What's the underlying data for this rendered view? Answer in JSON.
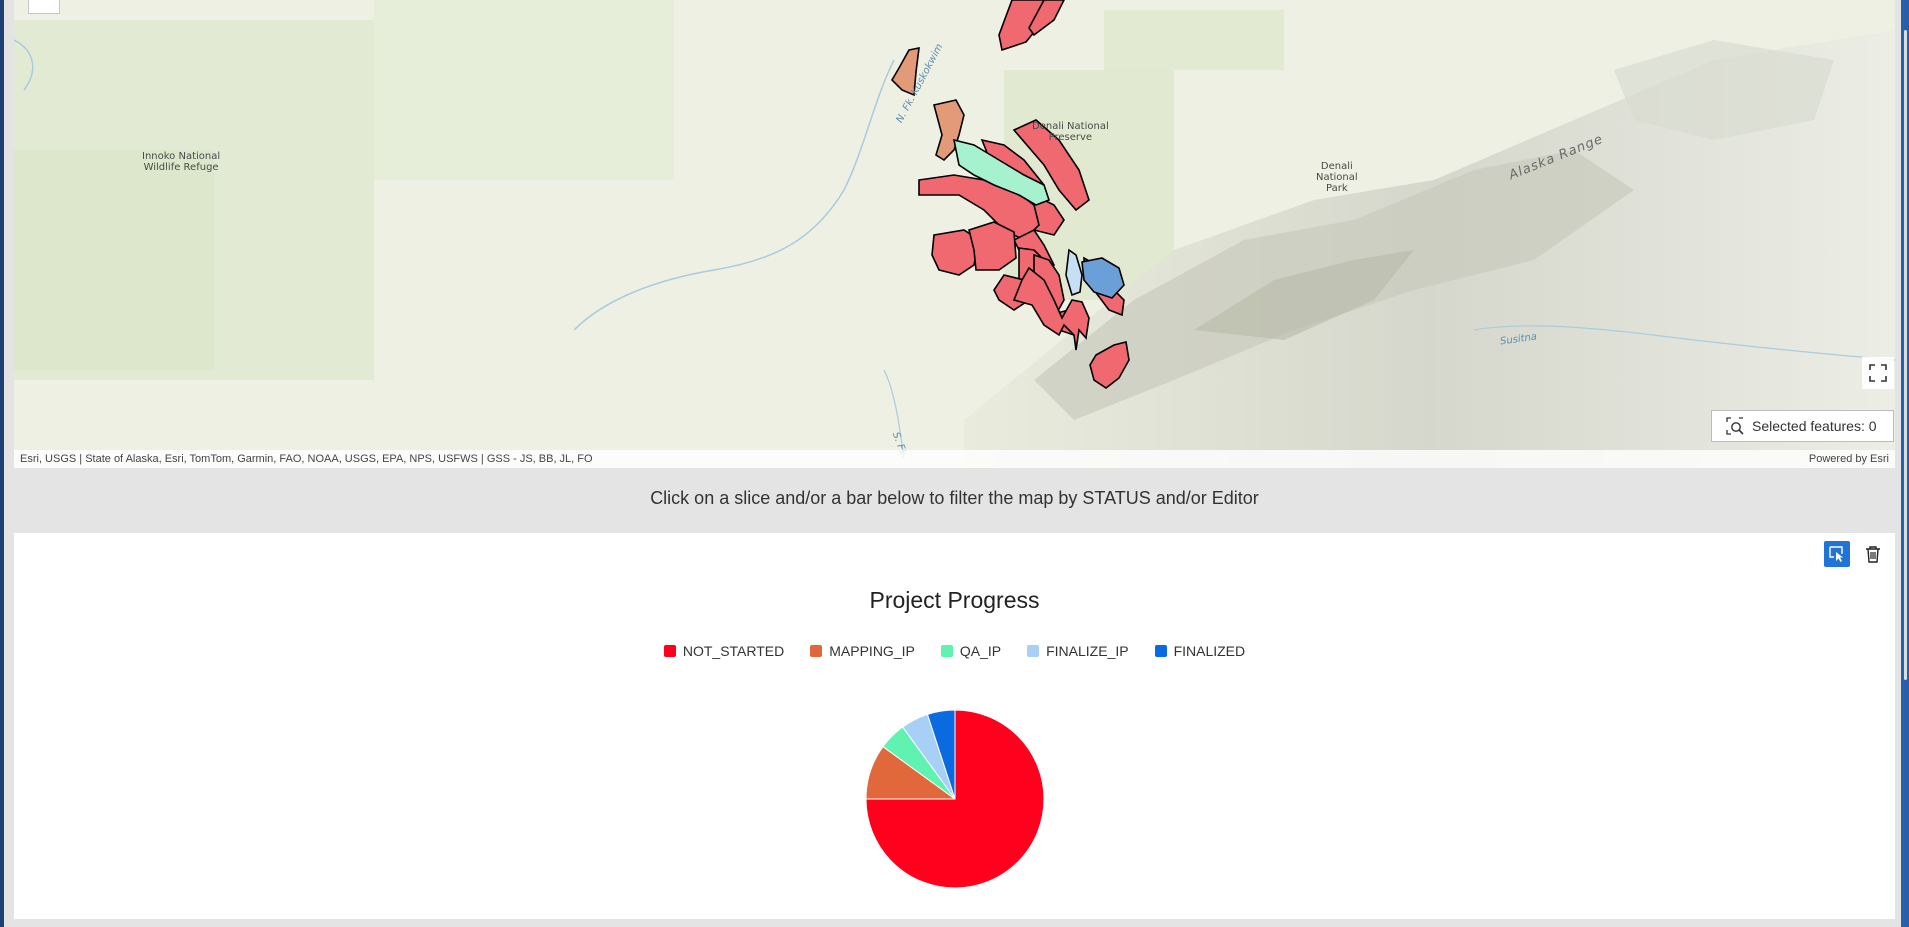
{
  "map": {
    "place_labels": [
      {
        "id": "innoko",
        "text": "Innoko National\nWildlife Refuge"
      },
      {
        "id": "denali-preserve",
        "text": "Denali National\nPreserve"
      },
      {
        "id": "denali-park",
        "text": "Denali\nNational\nPark"
      }
    ],
    "river_labels": {
      "north_fork": "N. Fk. Kuskokwim",
      "susitna": "Susitna",
      "south_fork": "S. Fk."
    },
    "range_label": "Alaska Range",
    "selected_features_label": "Selected features: 0",
    "attribution_left": "Esri, USGS | State of Alaska, Esri, TomTom, Garmin, FAO, NOAA, USGS, EPA, NPS, USFWS | GSS - JS, BB, JL, FO",
    "attribution_right": "Powered by Esri",
    "status_colors": {
      "NOT_STARTED": "#f06870",
      "MAPPING_IP": "#e29a78",
      "QA_IP": "#a6f2cf",
      "FINALIZE_IP": "#c7dff5",
      "FINALIZED": "#6a9fd8"
    }
  },
  "instruction": "Click on a slice and/or a bar below to filter the map by STATUS and/or Editor",
  "chart_data": {
    "type": "pie",
    "title": "Project Progress",
    "categories": [
      "NOT_STARTED",
      "MAPPING_IP",
      "QA_IP",
      "FINALIZE_IP",
      "FINALIZED"
    ],
    "values": [
      75,
      10,
      5,
      5,
      5
    ],
    "colors": [
      "#ff001d",
      "#e0683a",
      "#5ff2b0",
      "#a8d0f7",
      "#0a6be0"
    ],
    "legend_position": "top"
  },
  "icons": {
    "fullscreen": "fullscreen-icon",
    "selected_features": "zoom-to-selection-icon",
    "select_tool": "select-cursor-icon",
    "clear_tool": "trash-icon"
  }
}
